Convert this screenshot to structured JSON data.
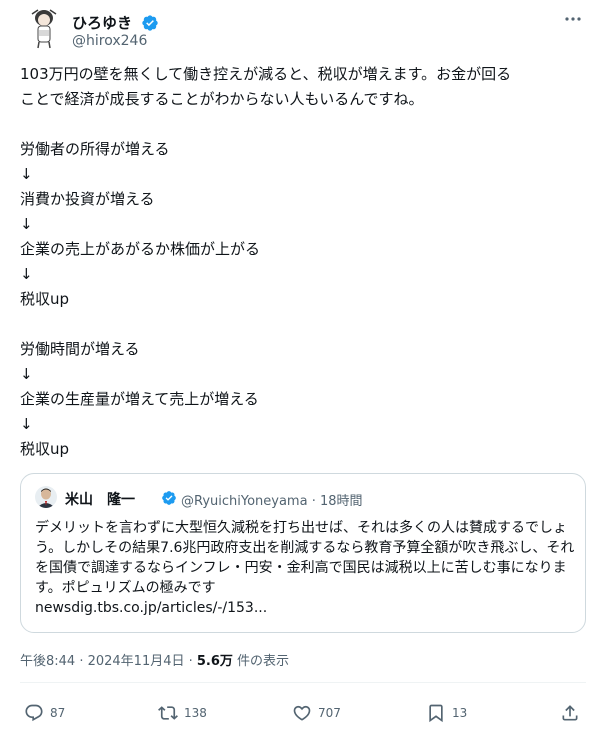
{
  "author": {
    "display_name": "ひろゆき",
    "handle": "@hirox246"
  },
  "tweet": {
    "lines": [
      "103万円の壁を無くして働き控えが減ると、税収が増えます。お金が回る",
      "ことで経済が成長することがわからない人もいるんですね。",
      "",
      "労働者の所得が増える",
      "↓",
      "消費か投資が増える",
      "↓",
      "企業の売上があがるか株価が上がる",
      "↓",
      "税収up",
      "",
      "労働時間が増える",
      "↓",
      "企業の生産量が増えて売上が増える",
      "↓",
      "税収up"
    ]
  },
  "quote": {
    "display_name": "米山　隆一",
    "handle": "@RyuichiYoneyama",
    "time": "18時間",
    "handle_time": "@RyuichiYoneyama · 18時間",
    "text": "デメリットを言わずに大型恒久減税を打ち出せば、それは多くの人は賛成するでしょう。しかしその結果7.6兆円政府支出を削減するなら教育予算全額が吹き飛ぶし、それを国債で調達するならインフレ・円安・金利高で国民は減税以上に苦しむ事になります。ポピュリズムの極みです",
    "link": "newsdig.tbs.co.jp/articles/-/153..."
  },
  "meta": {
    "timestamp": "午後8:44 · 2024年11月4日 · ",
    "views_count": "5.6万",
    "views_label": " 件の表示"
  },
  "actions": {
    "replies": "87",
    "reposts": "138",
    "likes": "707",
    "bookmarks": "13"
  },
  "colors": {
    "text": "#0f1419",
    "secondary": "#536471",
    "verified": "#1d9bf0",
    "border": "#cfd9de"
  },
  "icons": [
    "verified-badge-icon",
    "more-icon",
    "reply-icon",
    "repost-icon",
    "like-icon",
    "bookmark-icon",
    "share-icon"
  ]
}
